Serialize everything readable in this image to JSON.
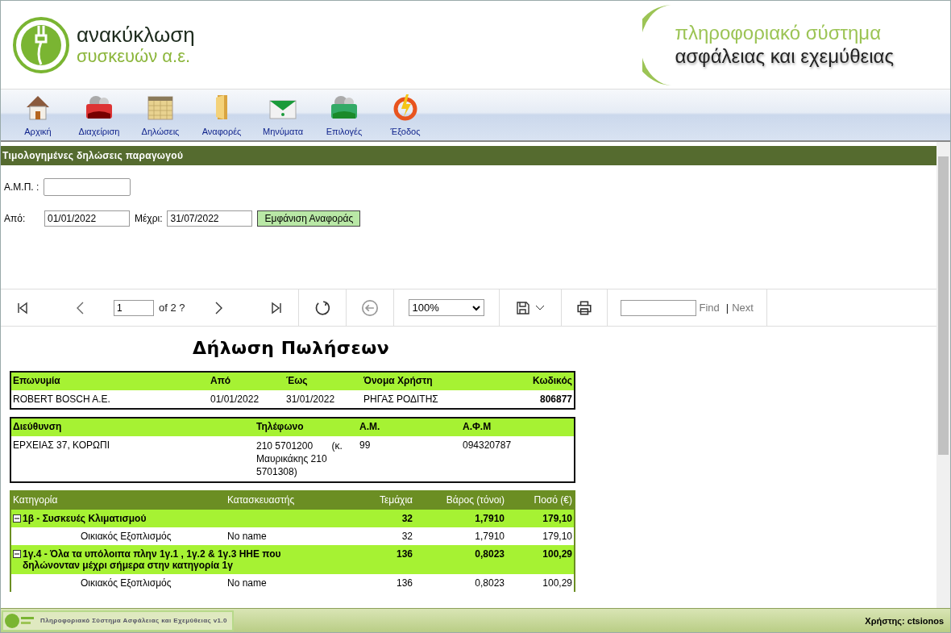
{
  "header": {
    "logo_line1": "ανακύκλωση",
    "logo_line2": "συσκευών α.ε.",
    "system_line1": "πληροφοριακό σύστημα",
    "system_line2": "ασφάλειας και εχεμύθειας"
  },
  "nav": [
    {
      "label": "Αρχική",
      "kind": "home"
    },
    {
      "label": "Διαχείριση",
      "kind": "admin"
    },
    {
      "label": "Δηλώσεις",
      "kind": "calendar"
    },
    {
      "label": "Αναφορές",
      "kind": "folder"
    },
    {
      "label": "Μηνύματα",
      "kind": "mail"
    },
    {
      "label": "Επιλογές",
      "kind": "options"
    },
    {
      "label": "Έξοδος",
      "kind": "power"
    }
  ],
  "section_title": "Τιμολογημένες δηλώσεις παραγωγού",
  "form": {
    "amp_label": "Α.Μ.Π. :",
    "from_label": "Από:",
    "from_value": "01/01/2022",
    "to_label": "Μέχρι:",
    "to_value": "31/07/2022",
    "submit": "Εμφάνιση Αναφοράς"
  },
  "viewer": {
    "page": "1",
    "page_of": "of 2 ?",
    "zoom": "100%",
    "find": "Find",
    "separator": "|",
    "next": "Next"
  },
  "report": {
    "title": "Δήλωση Πωλήσεων",
    "info_columns": [
      "Επωνυμία",
      "Από",
      "Έως",
      "Όνομα Χρήστη",
      "Κωδικός"
    ],
    "info_row": [
      "ROBERT BOSCH A.E.",
      "01/01/2022",
      "31/01/2022",
      "ΡΗΓΑΣ ΡΟΔΙΤΗΣ",
      "806877"
    ],
    "address_columns": [
      "Διεύθυνση",
      "Τηλέφωνο",
      "Α.Μ.",
      "Α.Φ.Μ"
    ],
    "address_row": [
      "ΕΡΧΕΙΑΣ 37, ΚΟΡΩΠΙ",
      "210 5701200       (κ. Μαυρικάκης 210 5701308)",
      "99",
      "094320787"
    ],
    "category_columns": [
      "Κατηγορία",
      "Κατασκευαστής",
      "Τεμάχια",
      "Βάρος (τόνοι)",
      "Ποσό (€)"
    ],
    "groups": [
      {
        "name": "1β - Συσκευές Κλιματισμού",
        "expanded": true,
        "pieces": "32",
        "weight": "1,7910",
        "amount": "179,10",
        "rows": [
          {
            "category": "Οικιακός Εξοπλισμός",
            "maker": "No name",
            "pieces": "32",
            "weight": "1,7910",
            "amount": "179,10"
          }
        ]
      },
      {
        "name": "1γ.4 - Όλα τα υπόλοιπα πλην 1γ.1 , 1γ.2 &  1γ.3 ΗΗΕ που δηλώνονταν μέχρι σήμερα στην κατηγορία 1γ",
        "expanded": true,
        "pieces": "136",
        "weight": "0,8023",
        "amount": "100,29",
        "rows": [
          {
            "category": "Οικιακός Εξοπλισμός",
            "maker": "No name",
            "pieces": "136",
            "weight": "0,8023",
            "amount": "100,29"
          }
        ]
      }
    ]
  },
  "status_bar": {
    "app": "Πληροφοριακό Σύστημα Ασφάλειας και Εχεμύθειας v1.0",
    "user": "Χρήστης: ctsionos"
  }
}
